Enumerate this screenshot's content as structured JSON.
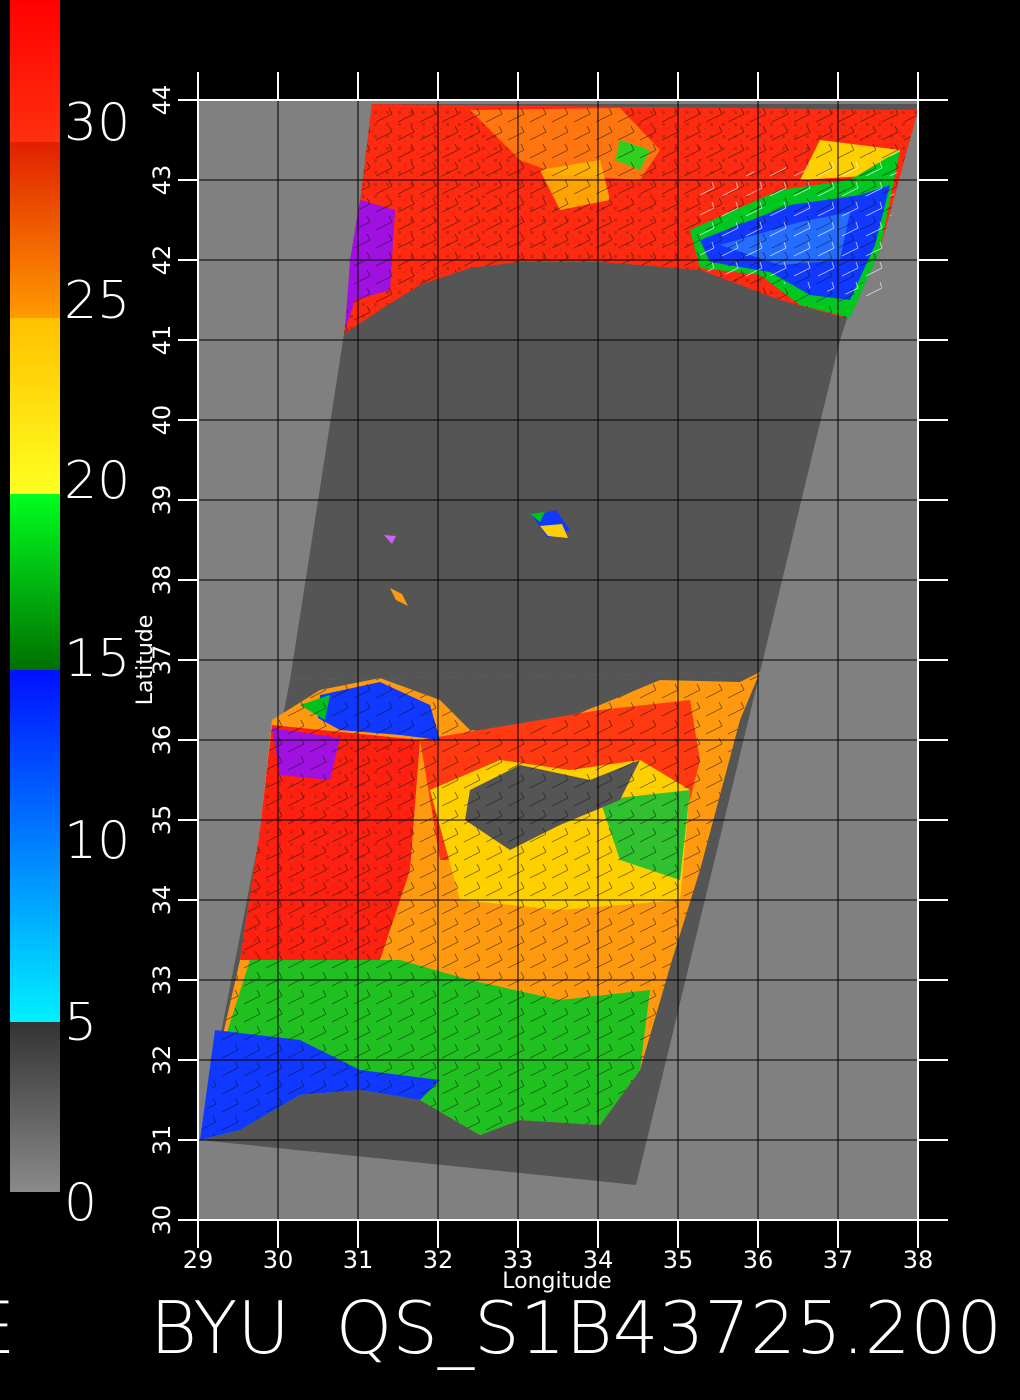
{
  "colorbar": {
    "labels": [
      "30",
      "25",
      "20",
      "15",
      "10",
      "5",
      "0"
    ],
    "colors": [
      "#ff1a1a",
      "#ff6a00",
      "#ffd000",
      "#00e000",
      "#0030ff",
      "#00e8ff",
      "#333333",
      "#888888"
    ]
  },
  "map": {
    "x_label": "Longitude",
    "y_label": "Latitude",
    "lon_ticks": [
      "29",
      "30",
      "31",
      "32",
      "33",
      "34",
      "35",
      "36",
      "37",
      "38"
    ],
    "lat_ticks": [
      "30",
      "31",
      "32",
      "33",
      "34",
      "35",
      "36",
      "37",
      "38",
      "39",
      "40",
      "41",
      "42",
      "43",
      "44"
    ],
    "lon_range": [
      29,
      38
    ],
    "lat_range": [
      30,
      44
    ],
    "background_color": "#808080",
    "no_data_color": "#555555"
  },
  "footer": {
    "left_glyph": "E",
    "title": "BYU  QS_S1B43725.200"
  }
}
